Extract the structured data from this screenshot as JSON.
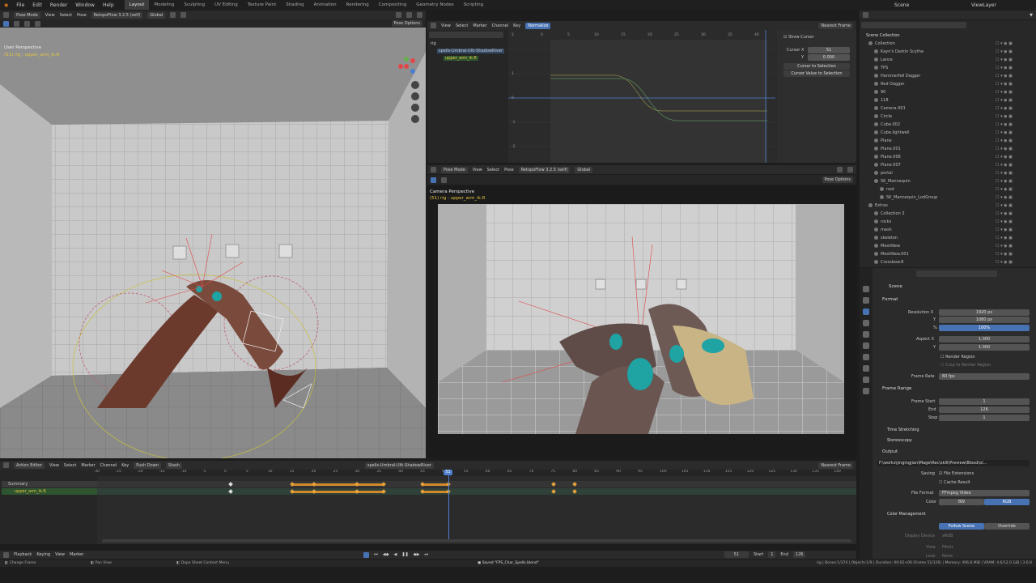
{
  "topbar": {
    "menus": [
      "File",
      "Edit",
      "Render",
      "Window",
      "Help"
    ],
    "workspaces": [
      "Layout",
      "Modeling",
      "Sculpting",
      "UV Editing",
      "Texture Paint",
      "Shading",
      "Animation",
      "Rendering",
      "Compositing",
      "Geometry Nodes",
      "Scripting"
    ],
    "active_workspace": "Layout",
    "scene": "Scene",
    "view_layer": "ViewLayer"
  },
  "viewport_left": {
    "mode": "Pose Mode",
    "menus": [
      "View",
      "Select",
      "Pose"
    ],
    "addon": "RetopoFlow 3.2.5 (self)",
    "orientation": "Global",
    "pose_options": "Pose Options",
    "title": "User Perspective",
    "subtitle": "(51) rig : upper_arm_ik.R"
  },
  "graph_editor": {
    "menus": [
      "View",
      "Select",
      "Marker",
      "Channel",
      "Key"
    ],
    "normalize": "Normalize",
    "snap": "Nearest Frame",
    "channels": [
      "rig",
      "spells-Umbral-Ulti-ShadowRiver",
      "upper_arm_ik.R"
    ],
    "x_ticks": [
      "0",
      "5",
      "10",
      "15",
      "20",
      "25",
      "30",
      "35",
      "40"
    ],
    "y_ticks": [
      "2",
      "1",
      "0",
      "-1",
      "-2"
    ],
    "show_cursor": "Show Cursor",
    "cursor_x_label": "Cursor X",
    "cursor_x": "51",
    "cursor_y_label": "Y",
    "cursor_y": "0.000",
    "cursor_to_selection": "Cursor to Selection",
    "cursor_value_to_selection": "Cursor Value to Selection"
  },
  "viewport_camera": {
    "mode": "Pose Mode",
    "menus": [
      "View",
      "Select",
      "Pose"
    ],
    "addon": "RetopoFlow 3.2.5 (self)",
    "orientation": "Global",
    "pose_options": "Pose Options",
    "title": "Camera Perspective",
    "subtitle": "(51) rig : upper_arm_ik.R"
  },
  "outliner": {
    "root": "Scene Collection",
    "items": [
      {
        "name": "Collection",
        "depth": 1
      },
      {
        "name": "Kayn's Darkin Scythe",
        "depth": 2
      },
      {
        "name": "Lance",
        "depth": 2
      },
      {
        "name": "TPS",
        "depth": 2
      },
      {
        "name": "Hammerfell Dagger",
        "depth": 2
      },
      {
        "name": "Red Dagger",
        "depth": 2
      },
      {
        "name": "90",
        "depth": 2
      },
      {
        "name": "118",
        "depth": 2
      },
      {
        "name": "Camera.001",
        "depth": 2
      },
      {
        "name": "Circle",
        "depth": 2
      },
      {
        "name": "Cube.002",
        "depth": 2
      },
      {
        "name": "Cube.lightwell",
        "depth": 2
      },
      {
        "name": "Plane",
        "depth": 2
      },
      {
        "name": "Plane.001",
        "depth": 2
      },
      {
        "name": "Plane.006",
        "depth": 2
      },
      {
        "name": "Plane.007",
        "depth": 2
      },
      {
        "name": "portal",
        "depth": 2
      },
      {
        "name": "SK_Mannequin",
        "depth": 2
      },
      {
        "name": "root",
        "depth": 3
      },
      {
        "name": "SK_Mannequin_LodGroup",
        "depth": 3
      },
      {
        "name": "Extras",
        "depth": 1
      },
      {
        "name": "Collection 3",
        "depth": 2
      },
      {
        "name": "rocks",
        "depth": 2
      },
      {
        "name": "mesh",
        "depth": 2
      },
      {
        "name": "skeleton",
        "depth": 2
      },
      {
        "name": "MeshNew",
        "depth": 2
      },
      {
        "name": "MeshNew.001",
        "depth": 2
      },
      {
        "name": "Crossbow.R",
        "depth": 2
      }
    ]
  },
  "properties": {
    "context": "Scene",
    "format_title": "Format",
    "res_x_label": "Resolution X",
    "res_x": "1920 px",
    "res_y_label": "Y",
    "res_y": "1080 px",
    "res_pct_label": "%",
    "res_pct": "100%",
    "aspect_x_label": "Aspect X",
    "aspect_x": "1.000",
    "aspect_y_label": "Y",
    "aspect_y": "1.000",
    "render_region": "Render Region",
    "crop": "Crop to Render Region",
    "frame_rate_label": "Frame Rate",
    "frame_rate": "60 fps",
    "frame_range_title": "Frame Range",
    "frame_start_label": "Frame Start",
    "frame_start": "1",
    "end_label": "End",
    "end": "126",
    "step_label": "Step",
    "step": "1",
    "time_stretching": "Time Stretching",
    "stereoscopy": "Stereoscopy",
    "output_title": "Output",
    "output_path": "F:\\works\\jingingjian\\Mage\\Rec\\skill\\Preview\\Blood\\ol...",
    "saving_label": "Saving",
    "file_extensions": "File Extensions",
    "cache_result": "Cache Result",
    "file_format_label": "File Format",
    "file_format": "FFmpeg Video",
    "color_label": "Color",
    "color_bw": "BW",
    "color_rgb": "RGB",
    "color_mgmt_title": "Color Management",
    "follow_scene": "Follow Scene",
    "override": "Override",
    "display_device_label": "Display Device",
    "display_device": "sRGB",
    "view_label": "View",
    "view_value": "Filmic",
    "look_label": "Look",
    "look_value": "None"
  },
  "dopesheet": {
    "mode": "Action Editor",
    "menus": [
      "View",
      "Select",
      "Marker",
      "Channel",
      "Key"
    ],
    "push_down": "Push Down",
    "stash": "Stash",
    "action": "spells-Umbral-Ulti-ShadowRiver",
    "snap": "Nearest Frame",
    "channels": [
      "Summary",
      "upper_arm_ik.R"
    ],
    "ticks": [
      "-30",
      "-25",
      "-20",
      "-15",
      "-10",
      "-5",
      "0",
      "5",
      "10",
      "15",
      "20",
      "25",
      "30",
      "35",
      "40",
      "45",
      "50",
      "55",
      "60",
      "65",
      "70",
      "75",
      "80",
      "85",
      "90",
      "95",
      "100",
      "105",
      "110",
      "115",
      "120",
      "125",
      "130",
      "135",
      "140"
    ],
    "current_frame": "51",
    "keyframes": [
      1,
      15,
      20,
      30,
      36,
      45,
      51,
      75,
      80
    ],
    "orange_ranges": [
      [
        15,
        36
      ],
      [
        45,
        51
      ]
    ]
  },
  "timeline": {
    "playback": "Playback",
    "keying": "Keying",
    "view": "View",
    "marker": "Marker",
    "current": "51",
    "start_label": "Start",
    "start": "1",
    "end_label": "End",
    "end": "126"
  },
  "status": {
    "left": "Change Frame",
    "mid1": "Pan View",
    "mid2": "Dope Sheet Context Menu",
    "saved": "Saved \"FPS_Char_Spells.blend\"",
    "right": "rig | Bones:1/374 | Objects:1/9 | Duration: 00:02+06 (Frame 51/126) | Memory: 496.8 MiB | VRAM: 4.6/12.0 GiB | 3.6.8"
  },
  "colors": {
    "accent": "#4772b3",
    "keyframe_selected": "#e8a23a",
    "playhead": "#4f7fd0",
    "teal": "#1fa3a3"
  }
}
